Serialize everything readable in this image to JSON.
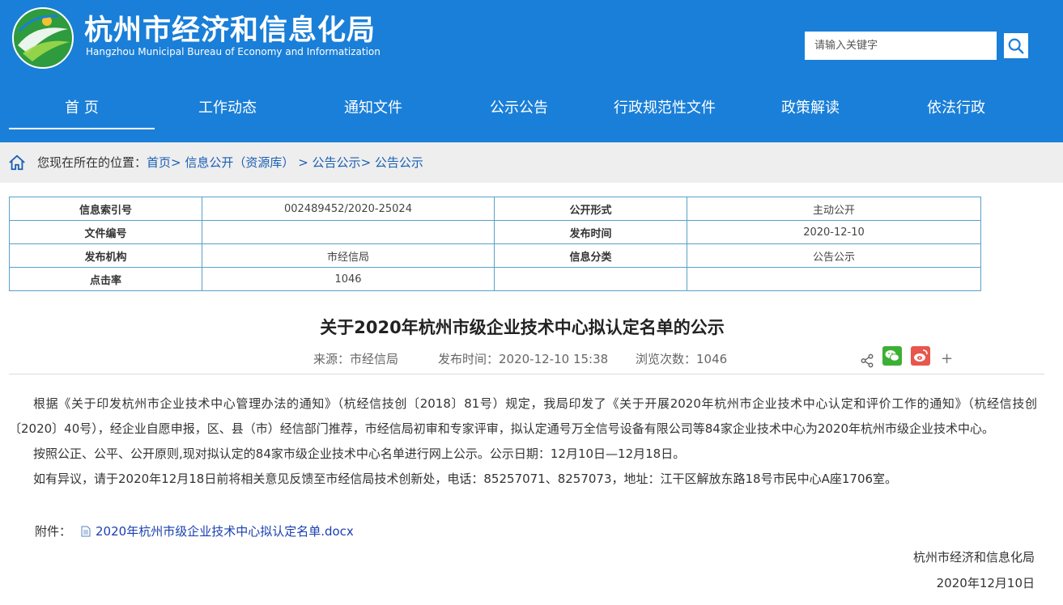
{
  "header": {
    "site_title": "杭州市经济和信息化局",
    "site_subtitle": "Hangzhou Municipal Bureau of Economy and Informatization",
    "logo_icon": "hangzhou-bureau-logo",
    "search": {
      "placeholder": "请输入关键字",
      "value": "",
      "icon": "search-icon"
    }
  },
  "nav": {
    "items": [
      {
        "label": "首 页",
        "active": true
      },
      {
        "label": "工作动态"
      },
      {
        "label": "通知文件"
      },
      {
        "label": "公示公告"
      },
      {
        "label": "行政规范性文件"
      },
      {
        "label": "政策解读"
      },
      {
        "label": "依法行政"
      }
    ]
  },
  "breadcrumb": {
    "prefix": "您现在所在的位置：",
    "items": [
      "首页",
      "信息公开（资源库）",
      "公告公示",
      "公告公示"
    ],
    "separator": ">"
  },
  "info_table": {
    "index_label": "信息索引号",
    "index_value": "002489452/2020-25024",
    "form_label": "公开形式",
    "form_value": "主动公开",
    "doc_no_label": "文件编号",
    "doc_no_value": "",
    "pub_time_label": "发布时间",
    "pub_time_value": "2020-12-10",
    "org_label": "发布机构",
    "org_value": "市经信局",
    "category_label": "信息分类",
    "category_value": "公告公示",
    "clicks_label": "点击率",
    "clicks_value": "1046"
  },
  "article": {
    "title": "关于2020年杭州市级企业技术中心拟认定名单的公示",
    "meta": {
      "source": "来源：市经信局",
      "publish_time": "发布时间：2020-12-10 15:38",
      "views": "浏览次数：1046"
    },
    "paragraphs": [
      "根据《关于印发杭州市企业技术中心管理办法的通知》（杭经信技创〔2018〕81号）规定，我局印发了《关于开展2020年杭州市企业技术中心认定和评价工作的通知》（杭经信技创〔2020〕40号），经企业自愿申报，区、县（市）经信部门推荐，市经信局初审和专家评审，拟认定通号万全信号设备有限公司等84家企业技术中心为2020年杭州市级企业技术中心。",
      "按照公正、公平、公开原则,现对拟认定的84家市级企业技术中心名单进行网上公示。公示日期：12月10日—12月18日。",
      "如有异议，请于2020年12月18日前将相关意见反馈至市经信局技术创新处，电话：85257071、8257073，地址：江干区解放东路18号市民中心A座1706室。"
    ],
    "attachment_label": "附件：",
    "attachment_name": "2020年杭州市级企业技术中心拟认定名单.docx",
    "signature_org": "杭州市经济和信息化局",
    "signature_date": "2020年12月10日"
  },
  "share": {
    "share_icon": "share-icon",
    "wechat_icon": "wechat-icon",
    "weibo_icon": "weibo-icon",
    "more": "+"
  },
  "colors": {
    "header_bg": "#1a7fd8",
    "breadcrumb_bg": "#eeeeee",
    "link": "#1a5fb4",
    "table_border": "#5aa0c8",
    "wechat": "#3cb034",
    "weibo": "#e8564c"
  }
}
